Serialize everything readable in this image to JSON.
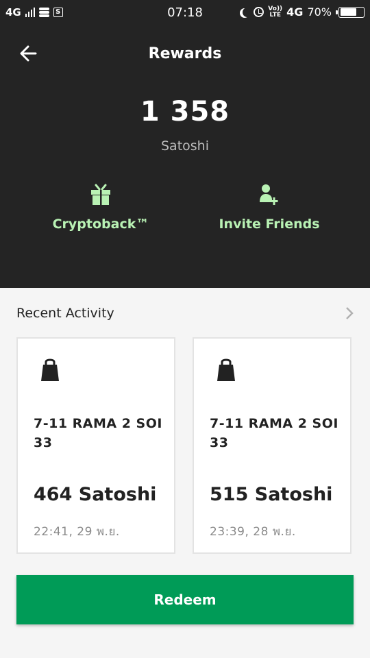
{
  "status_bar": {
    "network": "4G",
    "time": "07:18",
    "volte_top": "Vo))",
    "volte_bottom": "LTE",
    "network2": "4G",
    "battery": "70%",
    "battery_level": 0.7
  },
  "header": {
    "title": "Rewards",
    "balance": "1 358",
    "balance_unit": "Satoshi"
  },
  "actions": [
    {
      "label": "Cryptoback™",
      "icon": "gift-icon"
    },
    {
      "label": "Invite Friends",
      "icon": "add-user-icon"
    }
  ],
  "recent": {
    "heading": "Recent Activity",
    "items": [
      {
        "merchant": "7-11 RAMA 2 SOI 33",
        "amount": "464 Satoshi",
        "date": "22:41, 29 พ.ย.",
        "icon": "shopping-bag-icon"
      },
      {
        "merchant": "7-11 RAMA 2 SOI 33",
        "amount": "515 Satoshi",
        "date": "23:39, 28 พ.ย.",
        "icon": "shopping-bag-icon"
      }
    ]
  },
  "redeem_label": "Redeem",
  "colors": {
    "header_bg": "#242424",
    "accent_green": "#b9f2b4",
    "button_green": "#009b57"
  }
}
